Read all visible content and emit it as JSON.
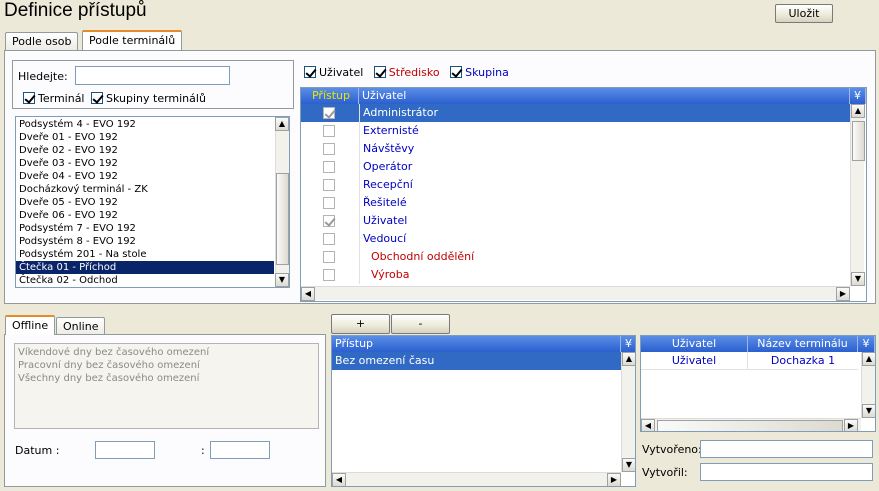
{
  "title": "Definice přístupů",
  "save_label": "Uložit",
  "top_tabs": [
    {
      "label": "Podle osob"
    },
    {
      "label": "Podle terminálů"
    }
  ],
  "search": {
    "label": "Hledejte:",
    "value": ""
  },
  "filters": {
    "terminal": "Terminál",
    "groups": "Skupiny terminálů"
  },
  "terminals": [
    "Podsystém 4 - EVO 192",
    "Dveře 01 - EVO 192",
    "Dveře 02 - EVO 192",
    "Dveře 03 - EVO 192",
    "Dveře 04 - EVO 192",
    "Docházkový terminál - ZK",
    "Dveře 05 - EVO 192",
    "Dveře 06 - EVO 192",
    "Podsystém 7 - EVO 192",
    "Podsystém 8 - EVO 192",
    "Podsystém 201 - Na stole",
    "Čtečka 01 - Příchod",
    "Čtečka 02 - Odchod"
  ],
  "user_filters": {
    "user": "Uživatel",
    "center": "Středisko",
    "group": "Skupina"
  },
  "access_grid": {
    "headers": {
      "access": "Přístup",
      "user": "Uživatel"
    },
    "rows": [
      {
        "name": "Administrátor",
        "checked": true
      },
      {
        "name": "Externisté",
        "checked": false
      },
      {
        "name": "Návštěvy",
        "checked": false
      },
      {
        "name": "Operátor",
        "checked": false
      },
      {
        "name": "Recepční",
        "checked": false
      },
      {
        "name": "Řešitelé",
        "checked": false
      },
      {
        "name": "Uživatel",
        "checked": true
      },
      {
        "name": "Vedoucí",
        "checked": false
      },
      {
        "name": "Obchodní oddělění",
        "checked": false
      },
      {
        "name": "Výroba",
        "checked": false
      }
    ]
  },
  "bottom_tabs": [
    {
      "label": "Offline"
    },
    {
      "label": "Online"
    }
  ],
  "offline_items": [
    "Víkendové dny bez časového omezení",
    "Pracovní dny bez časového omezení",
    "Všechny dny bez časového omezení"
  ],
  "date": {
    "label": "Datum :",
    "sep": ":"
  },
  "plus_label": "+",
  "minus_label": "-",
  "access_list": {
    "header": "Přístup",
    "items": [
      "Bez omezení času"
    ]
  },
  "user_terminal": {
    "headers": {
      "user": "Uživatel",
      "terminal": "Název terminálu"
    },
    "rows": [
      {
        "user": "Uživatel",
        "terminal": "Dochazka 1"
      }
    ]
  },
  "created": {
    "label": "Vytvořeno:",
    "value": ""
  },
  "created_by": {
    "label": "Vytvořil:",
    "value": ""
  }
}
